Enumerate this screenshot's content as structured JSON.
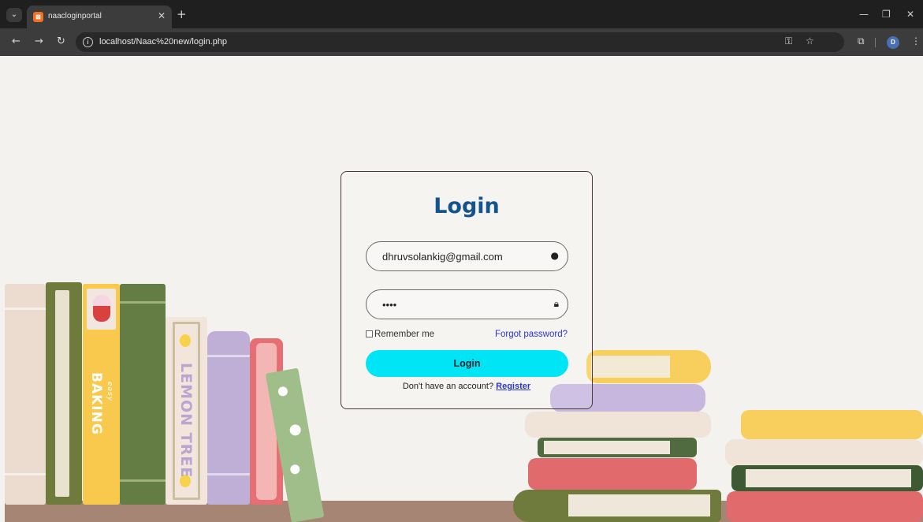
{
  "browser": {
    "tab_title": "naacloginportal",
    "url": "localhost/Naac%20new/login.php",
    "profile_initial": "D"
  },
  "login": {
    "title": "Login",
    "email_value": "dhruvsolankig@gmail.com",
    "password_value": "••••",
    "remember_label": "Remember me",
    "forgot_label": "Forgot password?",
    "button_label": "Login",
    "register_prompt": "Don't have an account?",
    "register_link": "Register"
  },
  "books": {
    "book1": "BAKING",
    "book1_small": "easy",
    "book2": "LEMON TREE"
  },
  "colors": {
    "title": "#13548f",
    "button": "#00e5f5",
    "link": "#2a36c9"
  }
}
